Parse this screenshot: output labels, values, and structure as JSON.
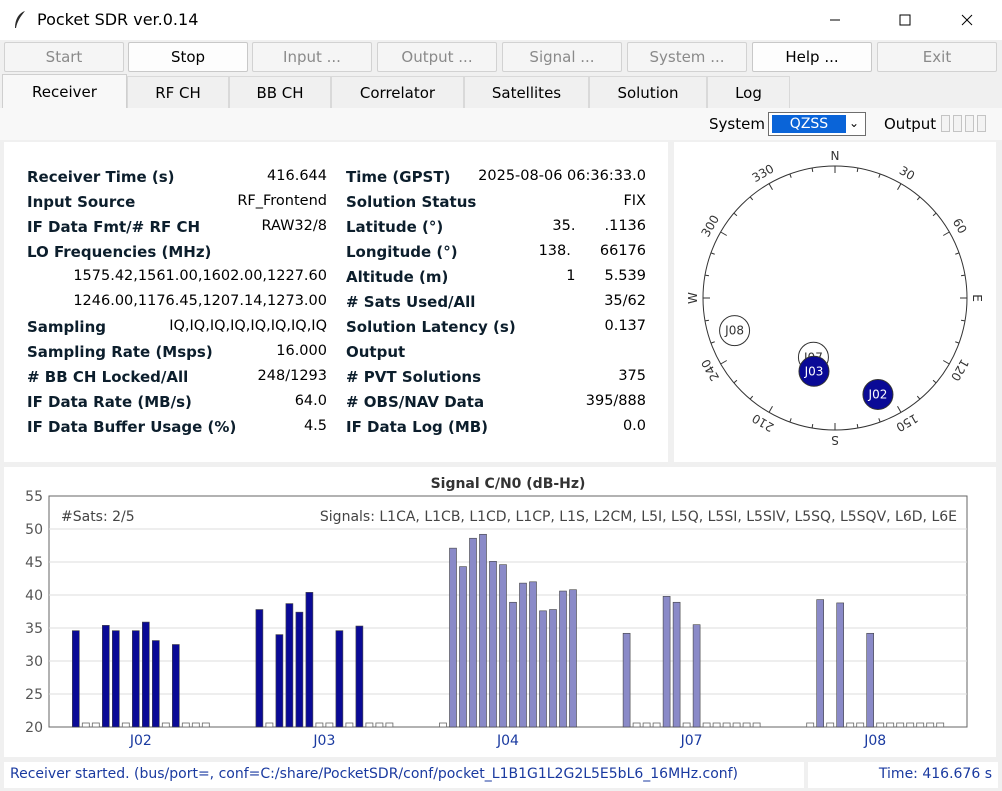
{
  "window": {
    "title": "Pocket SDR ver.0.14"
  },
  "toolbar": [
    {
      "label": "Start",
      "enabled": false
    },
    {
      "label": "Stop",
      "enabled": true
    },
    {
      "label": "Input ...",
      "enabled": false
    },
    {
      "label": "Output ...",
      "enabled": false
    },
    {
      "label": "Signal ...",
      "enabled": false
    },
    {
      "label": "System ...",
      "enabled": false
    },
    {
      "label": "Help ...",
      "enabled": true
    },
    {
      "label": "Exit",
      "enabled": false
    }
  ],
  "tabs": [
    "Receiver",
    "RF CH",
    "BB CH",
    "Correlator",
    "Satellites",
    "Solution",
    "Log"
  ],
  "active_tab": "Receiver",
  "system": {
    "label": "System",
    "value": "QZSS",
    "output_label": "Output"
  },
  "receiver_info": {
    "left": [
      {
        "label": "Receiver Time (s)",
        "value": "416.644"
      },
      {
        "label": "Input Source",
        "value": "RF_Frontend"
      },
      {
        "label": "IF Data Fmt/# RF CH",
        "value": "RAW32/8"
      },
      {
        "label": "LO Frequencies (MHz)",
        "value": ""
      },
      {
        "label": "",
        "value": "1575.42,1561.00,1602.00,1227.60"
      },
      {
        "label": "",
        "value": "1246.00,1176.45,1207.14,1273.00"
      },
      {
        "label": "Sampling",
        "value": "IQ,IQ,IQ,IQ,IQ,IQ,IQ,IQ"
      },
      {
        "label": "Sampling Rate (Msps)",
        "value": "16.000"
      },
      {
        "label": "# BB CH Locked/All",
        "value": "248/1293"
      },
      {
        "label": "IF Data Rate (MB/s)",
        "value": "64.0"
      },
      {
        "label": "IF Data Buffer Usage (%)",
        "value": "4.5"
      }
    ],
    "right": [
      {
        "label": "Time (GPST)",
        "value": "2025-08-06 06:36:33.0"
      },
      {
        "label": "Solution Status",
        "value": "FIX"
      },
      {
        "label": "Latitude (°)",
        "value": "35.  .1136"
      },
      {
        "label": "Longitude (°)",
        "value": "138.  66176"
      },
      {
        "label": "Altitude (m)",
        "value": "1  5.539"
      },
      {
        "label": "# Sats Used/All",
        "value": "35/62"
      },
      {
        "label": "Solution Latency (s)",
        "value": "0.137"
      },
      {
        "label": "Output",
        "value": ""
      },
      {
        "label": "# PVT Solutions",
        "value": "375"
      },
      {
        "label": "# OBS/NAV Data",
        "value": "395/888"
      },
      {
        "label": "IF Data Log (MB)",
        "value": "0.0"
      }
    ]
  },
  "skyplot": {
    "directions": {
      "N": "N",
      "E": "E",
      "S": "S",
      "W": "W"
    },
    "azimuth_labels": [
      "30",
      "60",
      "120",
      "150",
      "210",
      "240",
      "300",
      "330"
    ],
    "satellites": [
      {
        "id": "J08",
        "az": 252,
        "el": 18,
        "used": false
      },
      {
        "id": "J07",
        "az": 200,
        "el": 47,
        "used": false
      },
      {
        "id": "J03",
        "az": 196,
        "el": 38,
        "used": true
      },
      {
        "id": "J02",
        "az": 156,
        "el": 18,
        "used": true
      }
    ],
    "colors": {
      "used": "#0a0a96",
      "unused": "#ffffff"
    }
  },
  "chart_data": {
    "type": "bar",
    "title": "Signal C/N0 (dB-Hz)",
    "ylim": [
      20,
      55
    ],
    "yticks": [
      20,
      25,
      30,
      35,
      40,
      45,
      50,
      55
    ],
    "sats_text": "#Sats: 2/5",
    "signals_text": "Signals:  L1CA, L1CB, L1CD, L1CP, L1S, L2CM, L5I, L5Q, L5SI, L5SIV, L5SQ, L5SQV, L6D, L6E",
    "colors": {
      "used": "#0a0a96",
      "unused": "#8a8ac8"
    },
    "groups": [
      {
        "sat": "J02",
        "used": true,
        "values": [
          34.6,
          0,
          0,
          35.4,
          34.6,
          0,
          34.6,
          35.9,
          33.1,
          0,
          32.5,
          0,
          0,
          0
        ]
      },
      {
        "sat": "J03",
        "used": true,
        "values": [
          37.8,
          0,
          34.0,
          38.7,
          37.4,
          40.4,
          0,
          0,
          34.6,
          0,
          35.3,
          0,
          0,
          0
        ]
      },
      {
        "sat": "J04",
        "used": false,
        "values": [
          0,
          47.1,
          44.3,
          48.6,
          49.2,
          45.1,
          44.6,
          38.9,
          41.8,
          42.0,
          37.6,
          37.8,
          40.6,
          40.8
        ]
      },
      {
        "sat": "J07",
        "used": false,
        "values": [
          34.2,
          0,
          0,
          0,
          39.8,
          38.9,
          0,
          35.5,
          0,
          0,
          0,
          0,
          0,
          0
        ]
      },
      {
        "sat": "J08",
        "used": false,
        "values": [
          0,
          39.3,
          0,
          38.8,
          0,
          0,
          34.2,
          0,
          0,
          0,
          0,
          0,
          0,
          0
        ]
      }
    ]
  },
  "status": {
    "message": "Receiver started. (bus/port=, conf=C:/share/PocketSDR/conf/pocket_L1B1G1L2G2L5E5bL6_16MHz.conf)",
    "time": "Time: 416.676 s"
  }
}
